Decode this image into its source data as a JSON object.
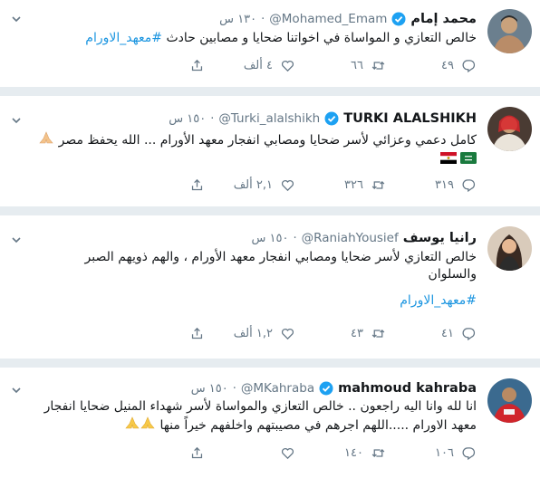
{
  "tweets": [
    {
      "name": "محمد إمام",
      "verified": true,
      "handle": "@Mohamed_Emam",
      "time": "١٣٠ س",
      "line1": "خالص التعازي و المواساة في اخواتنا ضحايا و مصابين حادث ",
      "hashtag": "#معهد_الاورام",
      "replies": "٤٩",
      "retweets": "٦٦",
      "likes": "٤ ألف"
    },
    {
      "name": "TURKI ALALSHIKH",
      "verified": true,
      "handle": "@Turki_alalshikh",
      "time": "١٥٠ س",
      "line1": "كامل دعمي وعزائي لأسر ضحايا ومصابي انفجار معهد الأورام ... الله يحفظ مصر",
      "replies": "٣١٩",
      "retweets": "٣٢٦",
      "likes": "٢,١ ألف"
    },
    {
      "name": "رانيا يوسف",
      "verified": false,
      "handle": "@RaniahYousief",
      "time": "١٥٠ س",
      "line1": "خالص التعازي  لأسر ضحايا ومصابي انفجار معهد الأورام ، والهم ذويهم  الصبر",
      "line2": "والسلوان",
      "hashtag": "#معهد_الاورام",
      "replies": "٤١",
      "retweets": "٤٣",
      "likes": "١,٢ ألف"
    },
    {
      "name": "mahmoud kahraba",
      "verified": true,
      "handle": "@MKahraba",
      "time": "١٥٠ س",
      "line1": "انا لله وانا اليه راجعون .. خالص التعازي والمواساة لأسر شهداء المنيل ضحايا انفجار",
      "line2": "معهد الاورام .....اللهم اجرهم في مصيبتهم واخلفهم خيراً منها",
      "replies": "١٠٦",
      "retweets": "١٤٠",
      "likes": ""
    }
  ],
  "colors": {
    "background": "#e6ecf0",
    "verified": "#1da1f2",
    "hashtag": "#1b95e0",
    "muted": "#657786"
  }
}
